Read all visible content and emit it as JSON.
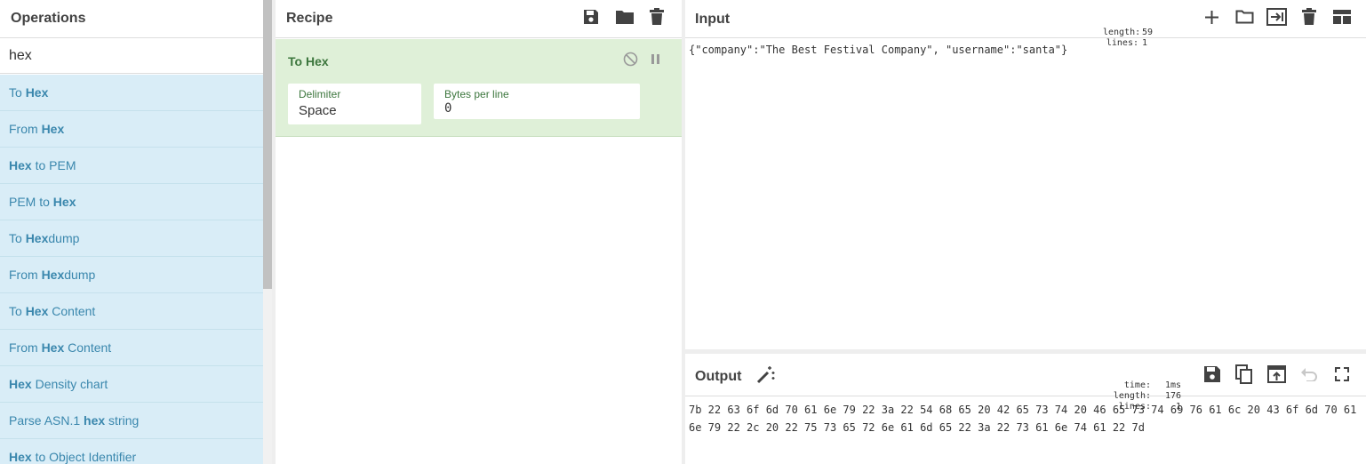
{
  "operations": {
    "title": "Operations",
    "search_value": "hex",
    "items": [
      {
        "pre": "To ",
        "match": "Hex",
        "post": ""
      },
      {
        "pre": "From ",
        "match": "Hex",
        "post": ""
      },
      {
        "pre": "",
        "match": "Hex",
        "post": " to PEM"
      },
      {
        "pre": "PEM to ",
        "match": "Hex",
        "post": ""
      },
      {
        "pre": "To ",
        "match": "Hex",
        "post": "dump"
      },
      {
        "pre": "From ",
        "match": "Hex",
        "post": "dump"
      },
      {
        "pre": "To ",
        "match": "Hex",
        "post": " Content"
      },
      {
        "pre": "From ",
        "match": "Hex",
        "post": " Content"
      },
      {
        "pre": "",
        "match": "Hex",
        "post": " Density chart"
      },
      {
        "pre": "Parse ASN.1 ",
        "match": "hex",
        "post": " string"
      },
      {
        "pre": "",
        "match": "Hex",
        "post": " to Object Identifier"
      }
    ]
  },
  "recipe": {
    "title": "Recipe",
    "operation": {
      "name": "To Hex",
      "args": [
        {
          "label": "Delimiter",
          "value": "Space"
        },
        {
          "label": "Bytes per line",
          "value": "0"
        }
      ]
    }
  },
  "input": {
    "title": "Input",
    "stats": {
      "length_label": "length:",
      "length": "59",
      "lines_label": "lines:",
      "lines": "1"
    },
    "text": "{\"company\":\"The Best Festival Company\", \"username\":\"santa\"}"
  },
  "output": {
    "title": "Output",
    "stats": {
      "time_label": "time:",
      "time": "1ms",
      "length_label": "length:",
      "length": "176",
      "lines_label": "lines:",
      "lines": "1"
    },
    "text": "7b 22 63 6f 6d 70 61 6e 79 22 3a 22 54 68 65 20 42 65 73 74 20 46 65 73 74 69 76 61 6c 20 43 6f 6d 70 61 6e 79 22 2c 20 22 75 73 65 72 6e 61 6d 65 22 3a 22 73 61 6e 74 61 22 7d"
  },
  "icons": {
    "recipe": [
      "save-icon",
      "folder-icon",
      "trash-icon"
    ],
    "recipe_op": [
      "disable-icon",
      "pause-icon"
    ],
    "input": [
      "plus-icon",
      "folder-icon",
      "input-output-icon",
      "trash-icon",
      "layout-icon"
    ],
    "output": [
      "magic-wand-icon",
      "save-icon",
      "copy-icon",
      "replace-input-icon",
      "undo-icon",
      "fullscreen-icon"
    ]
  },
  "colors": {
    "op_item_bg": "#d9edf7",
    "op_item_text": "#3a87ad",
    "recipe_op_bg": "#dff0d8",
    "recipe_op_text": "#3c763d"
  }
}
